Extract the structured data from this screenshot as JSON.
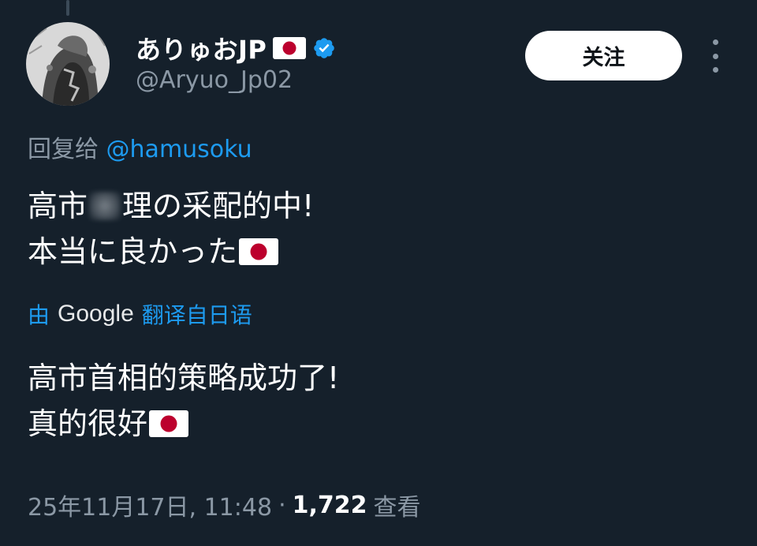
{
  "author": {
    "display_name": "ありゅおJP",
    "handle": "@Aryuo_Jp02",
    "verified": true
  },
  "follow_button": {
    "label": "关注"
  },
  "reply_to": {
    "prefix": "回复给",
    "mention": "@hamusoku"
  },
  "original_text": {
    "line1_part1": "高市",
    "line1_part2": "理の采配的中!",
    "line2": "本当に良かった"
  },
  "translation_bar": {
    "prefix": "由",
    "provider": "Google",
    "suffix": "翻译自日语"
  },
  "translated_text": {
    "line1": "高市首相的策略成功了!",
    "line2": "真的很好"
  },
  "meta": {
    "timestamp": "25年11月17日, 11:48",
    "separator": "·",
    "views_count": "1,722",
    "views_label": "查看"
  },
  "colors": {
    "background": "#15202b",
    "accent": "#1d9bf0",
    "muted": "#8b98a5"
  },
  "icons": {
    "verified": "verified-badge-icon",
    "more": "more-options-icon",
    "flag": "japan-flag-icon"
  }
}
